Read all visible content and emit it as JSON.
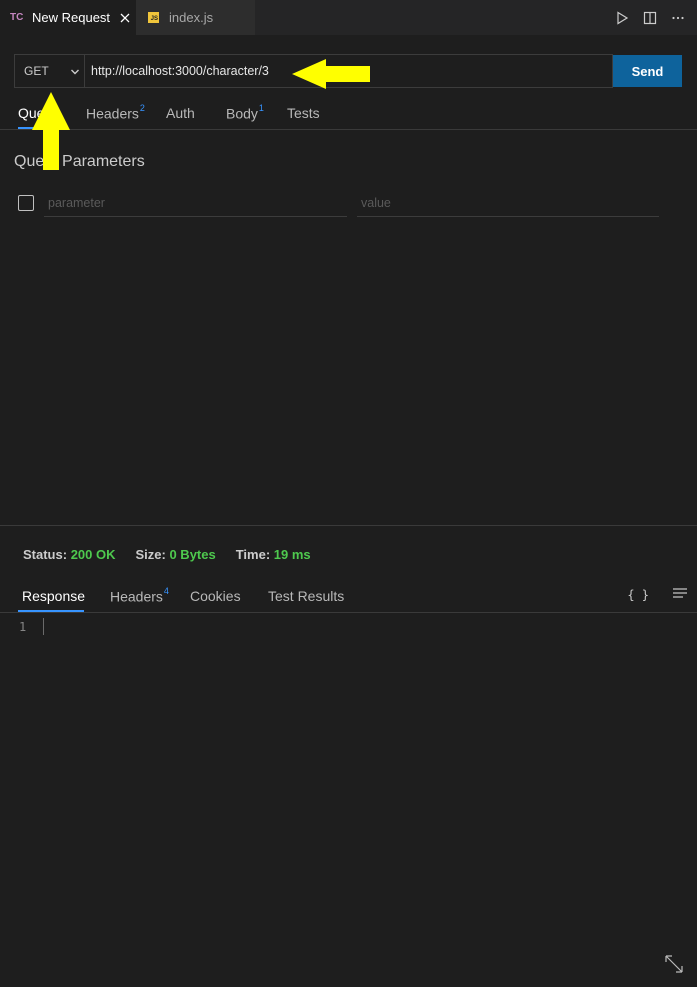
{
  "tabs": [
    {
      "icon": "TC",
      "label": "New Request",
      "active": true
    },
    {
      "icon": "js-icon",
      "label": "index.js",
      "active": false
    }
  ],
  "request": {
    "method": "GET",
    "url": "http://localhost:3000/character/3",
    "send_label": "Send"
  },
  "request_tabs": {
    "query": "Query",
    "headers": "Headers",
    "headers_count": "2",
    "auth": "Auth",
    "body": "Body",
    "body_count": "1",
    "tests": "Tests"
  },
  "query_params": {
    "title": "Query Parameters",
    "param_placeholder": "parameter",
    "value_placeholder": "value"
  },
  "response": {
    "status_label": "Status:",
    "status_value": "200 OK",
    "size_label": "Size:",
    "size_value": "0 Bytes",
    "time_label": "Time:",
    "time_value": "19 ms",
    "tabs": {
      "response": "Response",
      "headers": "Headers",
      "headers_count": "4",
      "cookies": "Cookies",
      "test_results": "Test Results"
    },
    "format_icon": "{ }",
    "line_number": "1"
  },
  "colors": {
    "accent": "#3794ff",
    "send_button": "#0e639c",
    "status_ok": "#4ec94e",
    "annotation_arrow": "#ffff00"
  }
}
